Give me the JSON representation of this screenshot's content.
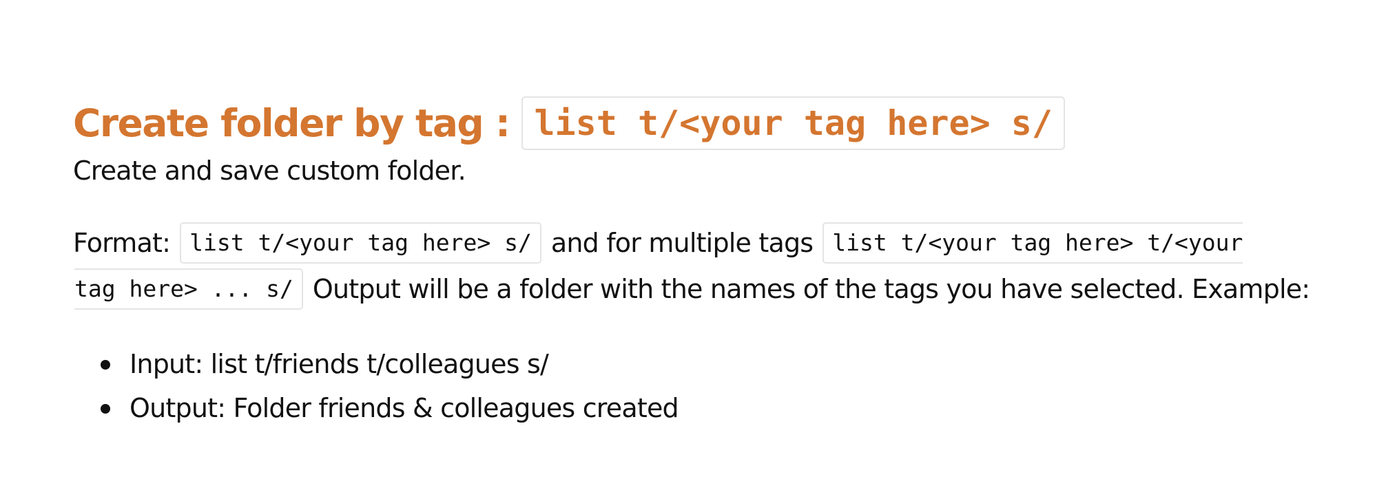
{
  "heading": {
    "text": "Create folder by tag :",
    "code": "list t/<your tag here> s/"
  },
  "description": "Create and save custom folder.",
  "format": {
    "label": "Format:",
    "code_single": "list t/<your tag here> s/",
    "mid_text": "and for multiple tags",
    "code_multi_part1": "list t/<your tag here> t/<your",
    "code_multi_part2": "tag here> ... s/",
    "trailing_text": "Output will be a folder with the names of the tags you have selected. Example:"
  },
  "examples": [
    {
      "text": "Input: list t/friends t/colleagues s/"
    },
    {
      "text": "Output: Folder friends & colleagues created"
    }
  ]
}
